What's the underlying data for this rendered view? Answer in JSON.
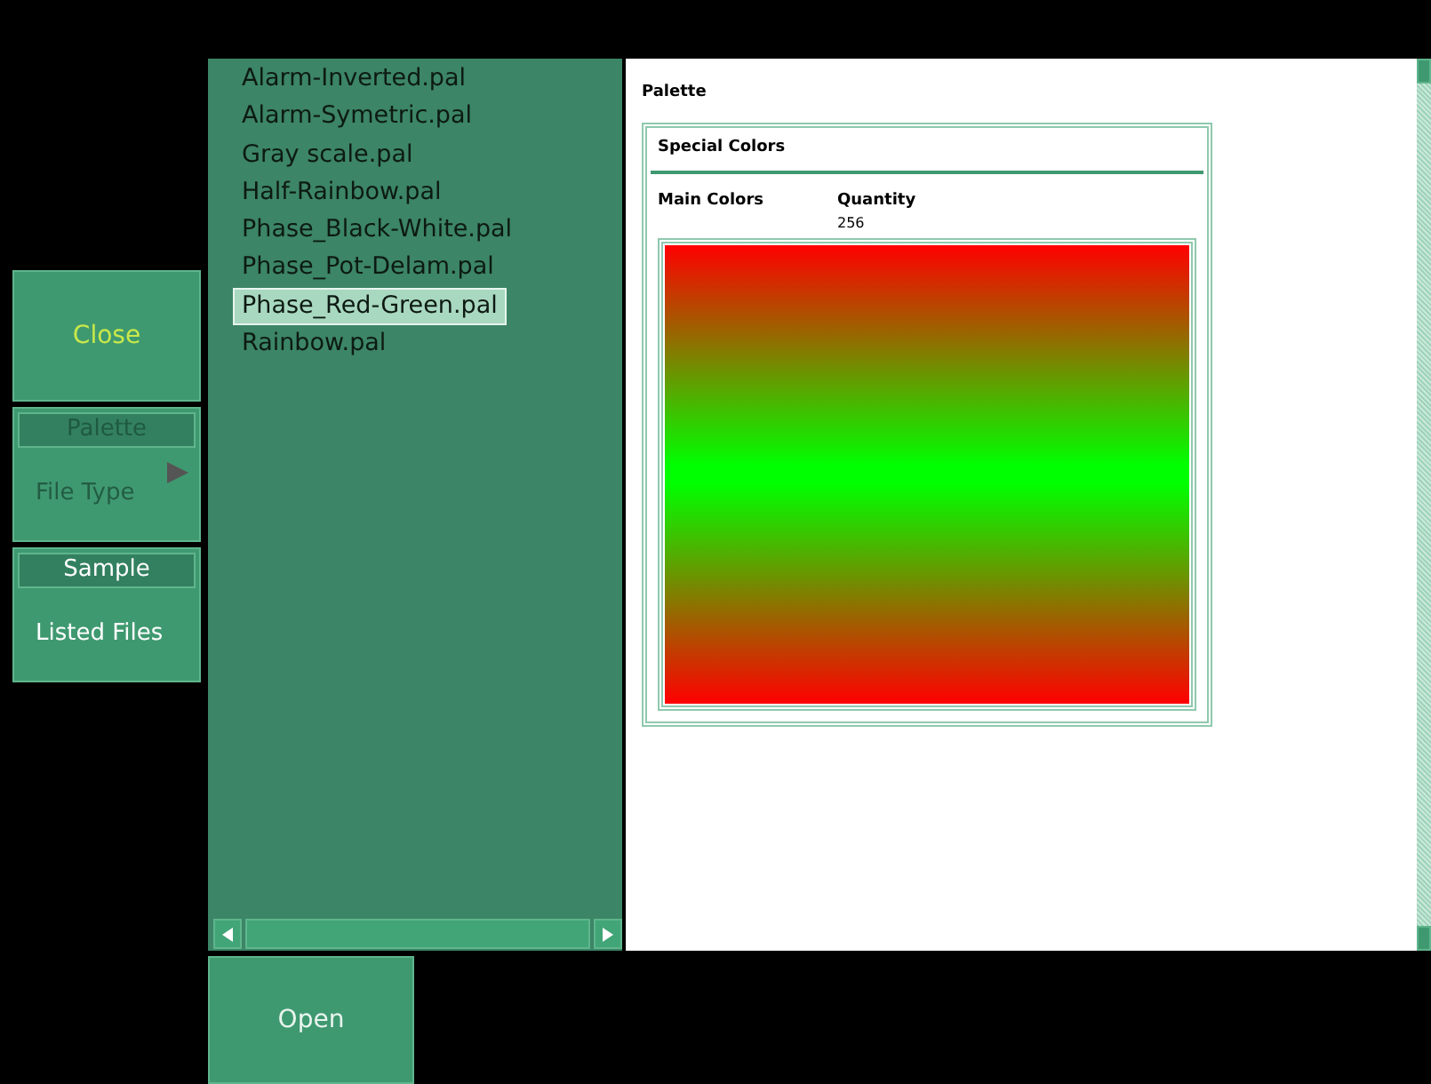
{
  "menu": [
    {
      "kind": "button",
      "label": "Close"
    },
    {
      "kind": "option",
      "caption": "Palette",
      "label": "File Type",
      "disabled": true
    },
    {
      "kind": "option",
      "caption": "Sample",
      "label": "Listed Files",
      "disabled": false
    }
  ],
  "files": [
    {
      "name": "Alarm-Inverted.pal",
      "selected": false
    },
    {
      "name": "Alarm-Symetric.pal",
      "selected": false
    },
    {
      "name": "Gray scale.pal",
      "selected": false
    },
    {
      "name": "Half-Rainbow.pal",
      "selected": false
    },
    {
      "name": "Phase_Black-White.pal",
      "selected": false
    },
    {
      "name": "Phase_Pot-Delam.pal",
      "selected": false
    },
    {
      "name": "Phase_Red-Green.pal",
      "selected": true
    },
    {
      "name": "Rainbow.pal",
      "selected": false
    }
  ],
  "preview": {
    "title": "Palette",
    "section": "Special Colors",
    "main_colors_label": "Main Colors",
    "quantity_label": "Quantity",
    "quantity": "256"
  },
  "open_button": "Open"
}
